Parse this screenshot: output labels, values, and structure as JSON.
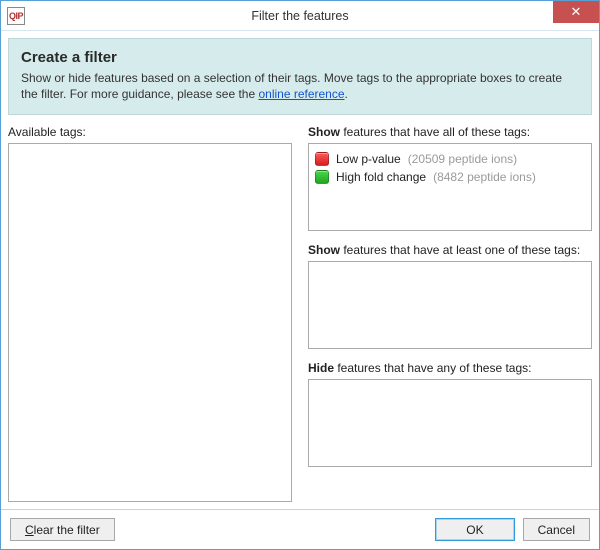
{
  "window": {
    "app_icon_text": "QIP",
    "title": "Filter the features",
    "close_glyph": "✕"
  },
  "info": {
    "title": "Create a filter",
    "body_pre": "Show or hide features based on a selection of their tags. Move tags to the appropriate boxes to create the filter. For more guidance, please see the ",
    "link_text": "online reference",
    "body_post": "."
  },
  "labels": {
    "available": "Available tags:",
    "show_all_b": "Show",
    "show_all_rest": " features that have all of these tags:",
    "show_any_b": "Show",
    "show_any_rest": " features that have at least one of these tags:",
    "hide_b": "Hide",
    "hide_rest": " features that have any of these tags:"
  },
  "tags": {
    "show_all": [
      {
        "swatch": "red",
        "name": "Low p-value",
        "count_text": "(20509 peptide ions)"
      },
      {
        "swatch": "green",
        "name": "High fold change",
        "count_text": "(8482 peptide ions)"
      }
    ]
  },
  "footer": {
    "clear_u": "C",
    "clear_rest": "lear the filter",
    "ok": "OK",
    "cancel": "Cancel"
  }
}
